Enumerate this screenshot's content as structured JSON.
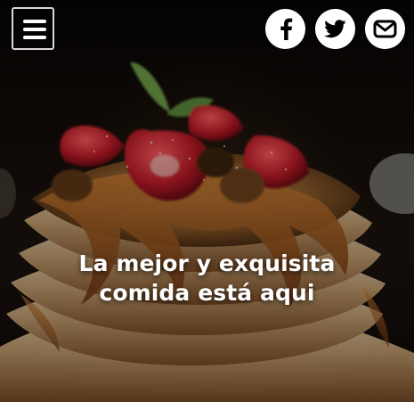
{
  "header": {
    "menu": {
      "icon": "hamburger-icon"
    },
    "social": [
      {
        "name": "facebook",
        "icon": "facebook-icon"
      },
      {
        "name": "twitter",
        "icon": "twitter-icon"
      },
      {
        "name": "email",
        "icon": "envelope-icon"
      }
    ]
  },
  "hero": {
    "headline_line1": "La mejor y exquisita",
    "headline_line2": "comida está aqui",
    "colors": {
      "text": "#ffffff",
      "overlay": "#000000",
      "button_border": "#d8d8d8"
    }
  }
}
